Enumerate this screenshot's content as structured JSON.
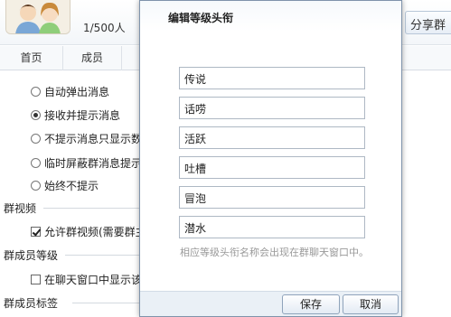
{
  "header": {
    "member_count": "1/500人",
    "share_label": "分享群"
  },
  "tabs": [
    {
      "label": "首页"
    },
    {
      "label": "成员"
    }
  ],
  "settings": {
    "message_options": [
      {
        "label": "自动弹出消息",
        "selected": false
      },
      {
        "label": "接收并提示消息",
        "selected": true
      },
      {
        "label": "不提示消息只显示数",
        "selected": false
      },
      {
        "label": "临时屏蔽群消息提示",
        "selected": false
      },
      {
        "label": "始终不提示",
        "selected": false
      }
    ],
    "video_section": {
      "title": "群视频",
      "option_label": "允许群视频(需要群主",
      "checked": true
    },
    "level_section": {
      "title": "群成员等级",
      "option_label": "在聊天窗口中显示该",
      "checked": false
    },
    "tag_section": {
      "title": "群成员标签"
    }
  },
  "dialog": {
    "title": "编辑等级头衔",
    "levels": [
      {
        "value": "传说"
      },
      {
        "value": "话唠"
      },
      {
        "value": "活跃"
      },
      {
        "value": "吐槽"
      },
      {
        "value": "冒泡"
      },
      {
        "value": "潜水"
      }
    ],
    "hint": "相应等级头衔名称会出现在群聊天窗口中。",
    "save_label": "保存",
    "cancel_label": "取消"
  },
  "colors": {
    "accent": "#7f93ab",
    "footer_bg": "#eaf0f6"
  }
}
